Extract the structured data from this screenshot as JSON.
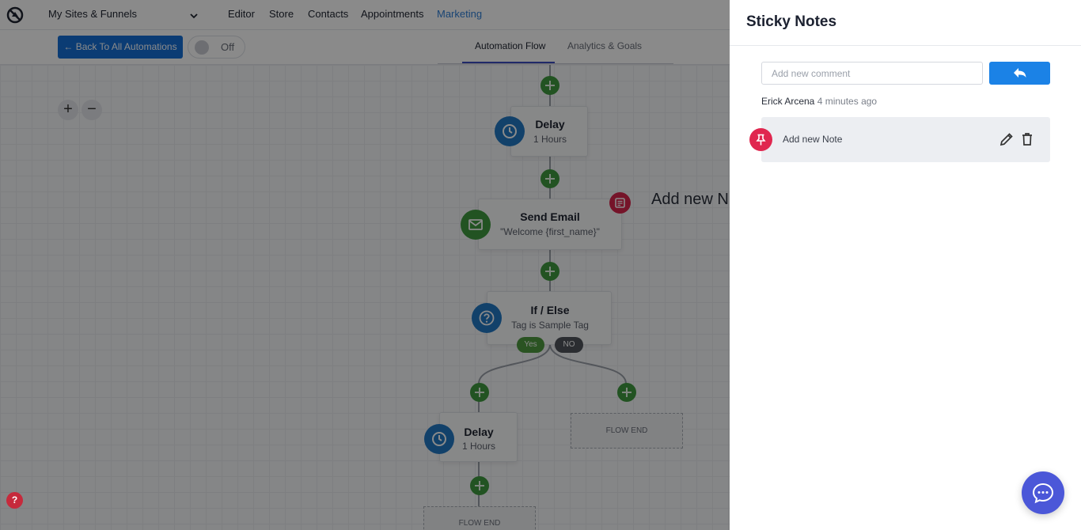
{
  "topnav": {
    "site_select": "My Sites & Funnels",
    "items": [
      {
        "label": "Editor"
      },
      {
        "label": "Store"
      },
      {
        "label": "Contacts"
      },
      {
        "label": "Appointments"
      },
      {
        "label": "Marketing",
        "active": true
      }
    ]
  },
  "toolbar": {
    "back_label": "← Back To All Automations",
    "toggle_label": "Off",
    "tabs": [
      {
        "label": "Automation Flow",
        "active": true
      },
      {
        "label": "Analytics & Goals"
      }
    ]
  },
  "zoom": {
    "in": "+",
    "out": "−"
  },
  "flow": {
    "nodes": [
      {
        "title": "Delay",
        "subtitle": "1 Hours",
        "icon": "clock-icon"
      },
      {
        "title": "Send Email",
        "subtitle": "\"Welcome {first_name}\"",
        "icon": "mail-icon"
      },
      {
        "title": "If / Else",
        "subtitle": "Tag is Sample Tag",
        "icon": "question-icon"
      },
      {
        "title": "Delay",
        "subtitle": "1 Hours",
        "icon": "clock-icon"
      }
    ],
    "branches": {
      "yes": "Yes",
      "no": "NO"
    },
    "flow_end": "FLOW END",
    "note_peek": "Add new N"
  },
  "help": "?",
  "sticky_notes": {
    "title": "Sticky Notes",
    "comment_placeholder": "Add new comment",
    "author": "Erick Arcena",
    "timestamp": "4 minutes ago",
    "note_text": "Add new Note"
  },
  "colors": {
    "primary_blue": "#1b82e6",
    "back_button_blue": "#1670d6",
    "add_green": "#3f9a3f",
    "note_red": "#e0264f",
    "chat_purple": "#4b57d8",
    "marketing_link": "#2f7fd6"
  }
}
